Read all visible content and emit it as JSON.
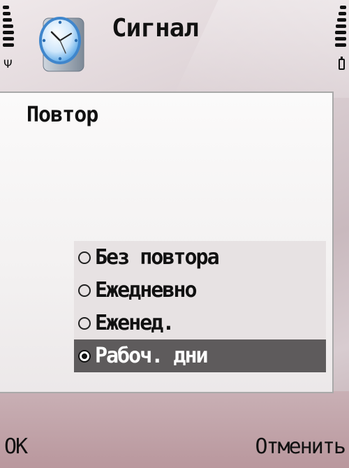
{
  "status": {
    "signal_icon": "signal-strength-icon",
    "antenna_icon": "antenna-icon",
    "battery_icon": "battery-icon"
  },
  "header": {
    "title": "Сигнал",
    "app_icon": "clock-icon"
  },
  "dialog": {
    "label": "Повтор",
    "options": [
      {
        "label": "Без повтора",
        "selected": false
      },
      {
        "label": "Ежедневно",
        "selected": false
      },
      {
        "label": "Еженед.",
        "selected": false
      },
      {
        "label": "Рабоч. дни",
        "selected": true
      }
    ]
  },
  "softkeys": {
    "left": "OK",
    "right": "Отменить"
  }
}
